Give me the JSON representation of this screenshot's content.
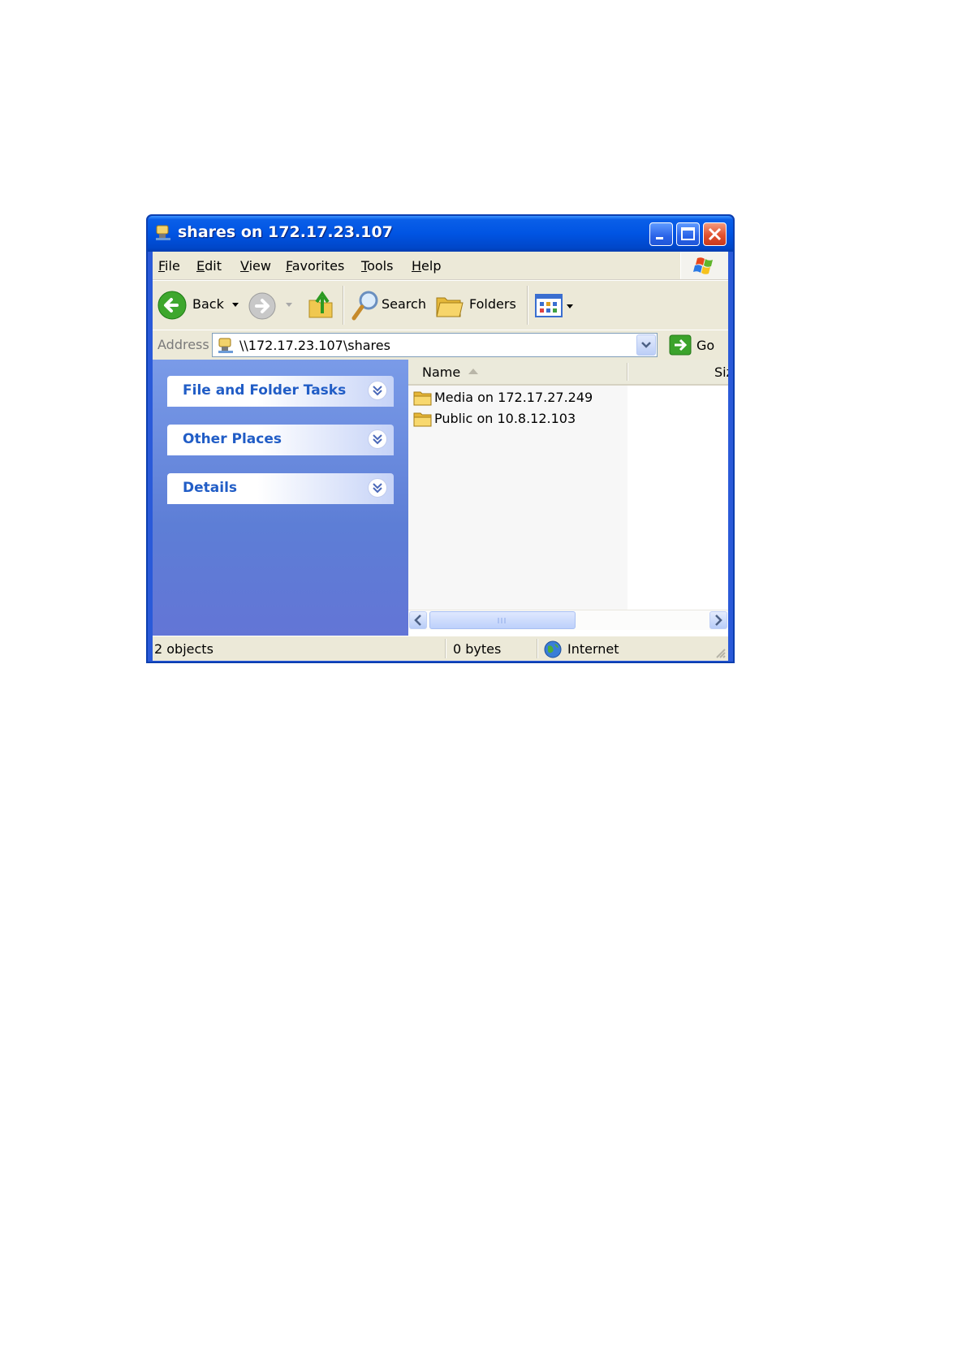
{
  "window": {
    "title": "shares on 172.17.23.107",
    "controls": {
      "minimize": "minimize",
      "maximize": "maximize",
      "close": "close"
    }
  },
  "menu": {
    "items": [
      "File",
      "Edit",
      "View",
      "Favorites",
      "Tools",
      "Help"
    ]
  },
  "toolbar": {
    "back_label": "Back",
    "search_label": "Search",
    "folders_label": "Folders"
  },
  "address": {
    "label": "Address",
    "value": "\\\\172.17.23.107\\shares",
    "go_label": "Go"
  },
  "tasks": {
    "panels": [
      "File and Folder Tasks",
      "Other Places",
      "Details"
    ]
  },
  "filelist": {
    "columns": {
      "name": "Name",
      "size": "Siz"
    },
    "sort": "ascending",
    "items": [
      {
        "name": "Media on 172.17.27.249"
      },
      {
        "name": "Public on 10.8.12.103"
      }
    ]
  },
  "status": {
    "objects": "2 objects",
    "size": "0 bytes",
    "zone": "Internet"
  },
  "colors": {
    "title_blue": "#0054e3",
    "task_blue": "#215dc6",
    "pane_bg": "#6f8fe0",
    "chrome": "#ece9d8"
  },
  "icons": [
    "network-share-icon",
    "windows-logo-icon",
    "back-arrow-icon",
    "forward-arrow-icon",
    "up-folder-icon",
    "search-icon",
    "folders-icon",
    "views-icon",
    "go-arrow-icon",
    "folder-icon",
    "globe-icon",
    "chevron-down-icon"
  ]
}
